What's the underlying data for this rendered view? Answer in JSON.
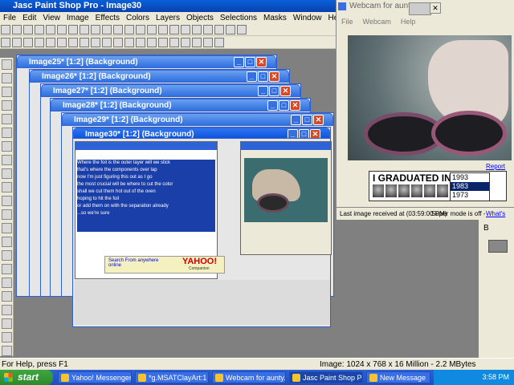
{
  "psp": {
    "title": "Jasc Paint Shop Pro - Image30",
    "menu": [
      "File",
      "Edit",
      "View",
      "Image",
      "Effects",
      "Colors",
      "Layers",
      "Objects",
      "Selections",
      "Masks",
      "Window",
      "Help"
    ],
    "status_left": "For Help, press F1",
    "status_right": "Image:  1024 x 768 x 16 Million - 2.2 MBytes"
  },
  "image_windows": [
    {
      "title": "Image25* [1:2] (Background)"
    },
    {
      "title": "Image26* [1:2] (Background)"
    },
    {
      "title": "Image27* [1:2] (Background)"
    },
    {
      "title": "Image28* [1:2] (Background)"
    },
    {
      "title": "Image29* [1:2] (Background)"
    },
    {
      "title": "Image30* [1:2] (Background)"
    }
  ],
  "webcam": {
    "title": "Webcam for aunty...",
    "menu": [
      "File",
      "Webcam",
      "Help"
    ],
    "report_link": "Report Abu",
    "graduated_label": "I GRADUATED IN:",
    "years": [
      "1993",
      "1983",
      "1973"
    ],
    "selected_year": "1983",
    "status": "Last image received at (03:59:00 PM)",
    "supermode": "Super mode is off - ",
    "whats_this": "What's this",
    "b_label": "B"
  },
  "taskbar": {
    "start": "start",
    "tasks": [
      {
        "label": "Yahoo! Messenger ..."
      },
      {
        "label": "*g.MSATClayArt:1 ..."
      },
      {
        "label": "Webcam for aunty..."
      },
      {
        "label": "Jasc Paint Shop Pro..."
      },
      {
        "label": "New Message"
      }
    ],
    "clock": "3:58 PM"
  },
  "inner_screenshot": {
    "ad_text": "Search From anywhere online",
    "ad_brand": "YAHOO!",
    "ad_sub": "Companion",
    "chat_lines": [
      "Where the foil is the outer layer will we stick",
      "that's where the components over lap",
      "now I'm just figuring this out as I go",
      "the most crucial will be where to cut the color",
      "shall we cut them hot out of the oven",
      "hoping to hit the foil",
      "or add them on with the separation already",
      "...so we're sure"
    ]
  },
  "colors": {
    "xp_blue": "#0a4fd8",
    "taskbar_blue": "#2d63d6",
    "start_green": "#3fa63f",
    "close_red": "#d84a26",
    "chat_highlight": "#1b3fa8"
  }
}
